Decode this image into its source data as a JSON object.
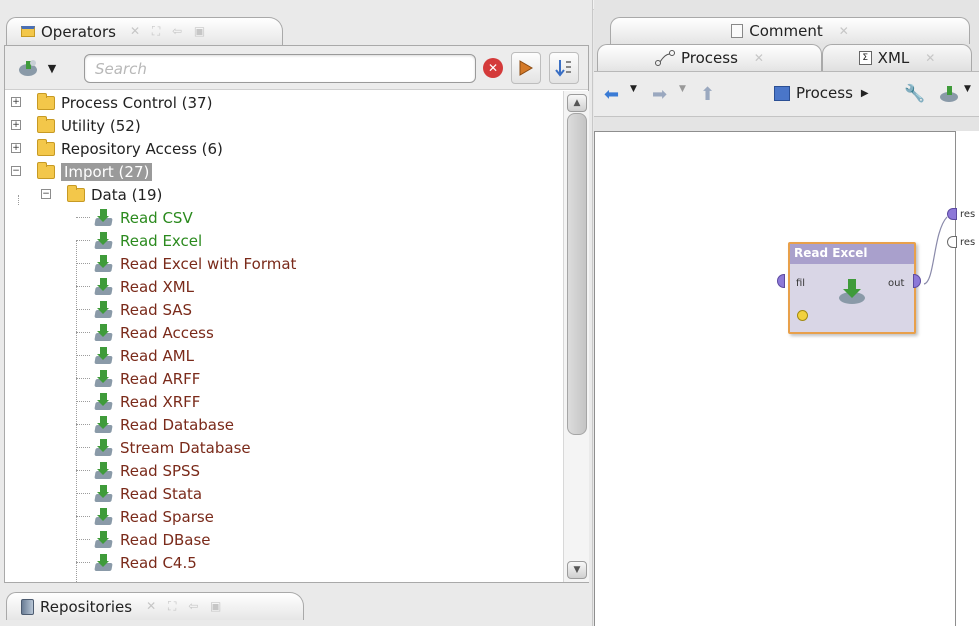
{
  "left_panel": {
    "operators_tab": {
      "label": "Operators"
    },
    "repositories_tab": {
      "label": "Repositories"
    },
    "search": {
      "placeholder": "Search"
    },
    "tree": {
      "folders": [
        {
          "label": "Process Control (37)"
        },
        {
          "label": "Utility (52)"
        },
        {
          "label": "Repository Access (6)"
        },
        {
          "label": "Import (27)"
        }
      ],
      "subfolder": {
        "label": "Data (19)"
      },
      "operators": [
        {
          "label": "Read CSV",
          "color": "#2b8a1e"
        },
        {
          "label": "Read Excel",
          "color": "#2b8a1e"
        },
        {
          "label": "Read Excel with Format",
          "color": "#7a2a1a"
        },
        {
          "label": "Read XML",
          "color": "#7a2a1a"
        },
        {
          "label": "Read SAS",
          "color": "#7a2a1a"
        },
        {
          "label": "Read Access",
          "color": "#7a2a1a"
        },
        {
          "label": "Read AML",
          "color": "#7a2a1a"
        },
        {
          "label": "Read ARFF",
          "color": "#7a2a1a"
        },
        {
          "label": "Read XRFF",
          "color": "#7a2a1a"
        },
        {
          "label": "Read Database",
          "color": "#7a2a1a"
        },
        {
          "label": "Stream Database",
          "color": "#7a2a1a"
        },
        {
          "label": "Read SPSS",
          "color": "#7a2a1a"
        },
        {
          "label": "Read Stata",
          "color": "#7a2a1a"
        },
        {
          "label": "Read Sparse",
          "color": "#7a2a1a"
        },
        {
          "label": "Read DBase",
          "color": "#7a2a1a"
        },
        {
          "label": "Read C4.5",
          "color": "#7a2a1a"
        }
      ]
    }
  },
  "right_panel": {
    "tabs": {
      "comment": "Comment",
      "process": "Process",
      "xml": "XML"
    },
    "toolbar": {
      "process_breadcrumb": "Process"
    },
    "operator_box": {
      "title": "Read Excel",
      "input_port": "fil",
      "output_port": "out"
    },
    "result_ports": [
      "res",
      "res"
    ]
  },
  "colors": {
    "operator_title_bg": "#a9a0cc",
    "operator_border": "#e8a04b",
    "green_label": "#2b8a1e",
    "brown_label": "#7a2a1a"
  }
}
